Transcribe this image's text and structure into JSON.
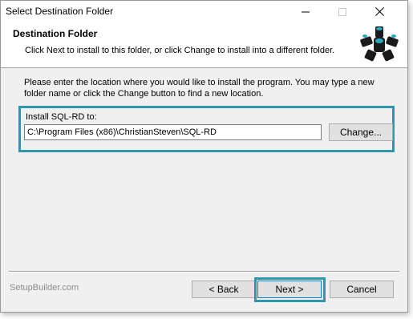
{
  "window": {
    "title": "Select Destination Folder",
    "controls": {
      "minimize": "minimize",
      "maximize": "maximize",
      "close": "close"
    }
  },
  "header": {
    "title": "Destination Folder",
    "subtitle": "Click  Next to install to this folder, or click Change to install into a different folder."
  },
  "body": {
    "instructions": "Please enter the location where you would like to install the program. You may type a new folder name or click the Change button to find a new location.",
    "install_label": "Install SQL-RD to:",
    "install_path": "C:\\Program Files (x86)\\ChristianSteven\\SQL-RD",
    "change_label": "Change..."
  },
  "footer": {
    "brand": "SetupBuilder.com",
    "back_label": "< Back",
    "next_label": "Next >",
    "cancel_label": "Cancel"
  },
  "colors": {
    "highlight": "#2f97ad",
    "logo": "#1a1a1a",
    "logo_accent": "#29a9c4"
  },
  "icons": [
    "setup-logo-icon",
    "minimize-icon",
    "maximize-icon",
    "close-icon"
  ]
}
